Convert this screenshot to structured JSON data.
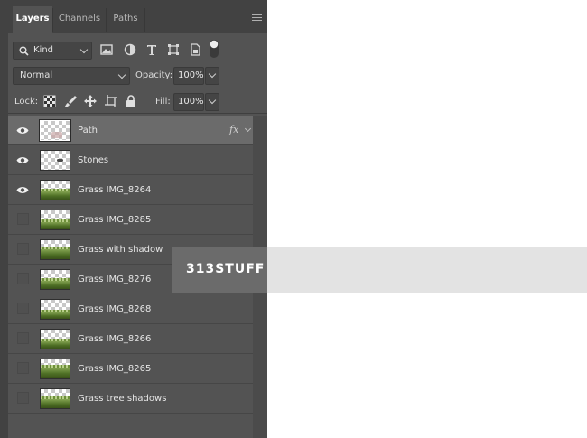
{
  "tabs": [
    {
      "label": "Layers",
      "active": true
    },
    {
      "label": "Channels",
      "active": false
    },
    {
      "label": "Paths",
      "active": false
    }
  ],
  "filter": {
    "kind_label": "Kind",
    "icons": [
      "image-filter-icon",
      "adjustment-filter-icon",
      "type-filter-icon",
      "shape-filter-icon",
      "smart-object-filter-icon",
      "filter-toggle-icon"
    ]
  },
  "blend": {
    "mode": "Normal",
    "opacity_label": "Opacity:",
    "opacity_value": "100%"
  },
  "lock": {
    "label": "Lock:",
    "icons": [
      "lock-transparent-pixels-icon",
      "lock-image-pixels-icon",
      "lock-position-icon",
      "lock-artboard-icon",
      "lock-all-icon"
    ],
    "fill_label": "Fill:",
    "fill_value": "100%"
  },
  "layers": [
    {
      "name": "Path",
      "visible": true,
      "selected": true,
      "fx": "fx",
      "thumb": "path"
    },
    {
      "name": "Stones",
      "visible": true,
      "selected": false,
      "thumb": "stones"
    },
    {
      "name": "Grass IMG_8264",
      "visible": true,
      "selected": false,
      "thumb": "grass"
    },
    {
      "name": "Grass IMG_8285",
      "visible": false,
      "selected": false,
      "thumb": "grass"
    },
    {
      "name": "Grass with shadow",
      "visible": false,
      "selected": false,
      "thumb": "grass"
    },
    {
      "name": "Grass IMG_8276",
      "visible": false,
      "selected": false,
      "thumb": "grass"
    },
    {
      "name": "Grass IMG_8268",
      "visible": false,
      "selected": false,
      "thumb": "grass"
    },
    {
      "name": "Grass IMG_8266",
      "visible": false,
      "selected": false,
      "thumb": "grass"
    },
    {
      "name": "Grass IMG_8265",
      "visible": false,
      "selected": false,
      "thumb": "grass"
    },
    {
      "name": "Grass tree shadows",
      "visible": false,
      "selected": false,
      "thumb": "grass"
    }
  ],
  "watermark": {
    "text": "313STUFF"
  },
  "colors": {
    "panel_bg": "#535353",
    "selected_layer": "#6b6b6b",
    "tab_bar": "#424242"
  }
}
